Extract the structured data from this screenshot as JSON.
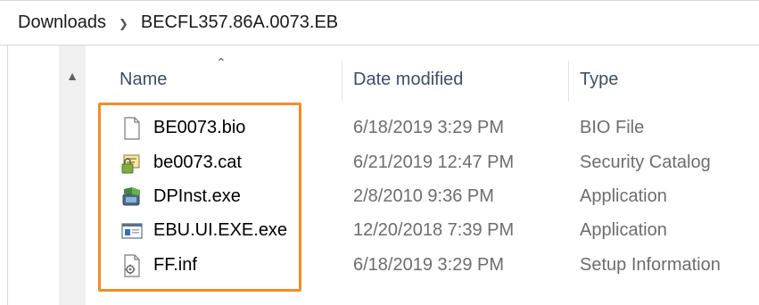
{
  "breadcrumb": {
    "items": [
      "Downloads",
      "BECFL357.86A.0073.EB"
    ],
    "separator": ">"
  },
  "columns": {
    "name": "Name",
    "date": "Date modified",
    "type": "Type"
  },
  "files": [
    {
      "name": "BE0073.bio",
      "date": "6/18/2019 3:29 PM",
      "type": "BIO File",
      "icon": "blank-document-icon"
    },
    {
      "name": "be0073.cat",
      "date": "6/21/2019 12:47 PM",
      "type": "Security Catalog",
      "icon": "security-catalog-icon"
    },
    {
      "name": "DPInst.exe",
      "date": "2/8/2010 9:36 PM",
      "type": "Application",
      "icon": "installer-app-icon"
    },
    {
      "name": "EBU.UI.EXE.exe",
      "date": "12/20/2018 7:39 PM",
      "type": "Application",
      "icon": "window-app-icon"
    },
    {
      "name": "FF.inf",
      "date": "6/18/2019 3:29 PM",
      "type": "Setup Information",
      "icon": "setup-info-icon"
    }
  ],
  "colors": {
    "highlight": "#f28c28",
    "header_text": "#3b4e6b",
    "secondary_text": "#6d6d6d"
  }
}
